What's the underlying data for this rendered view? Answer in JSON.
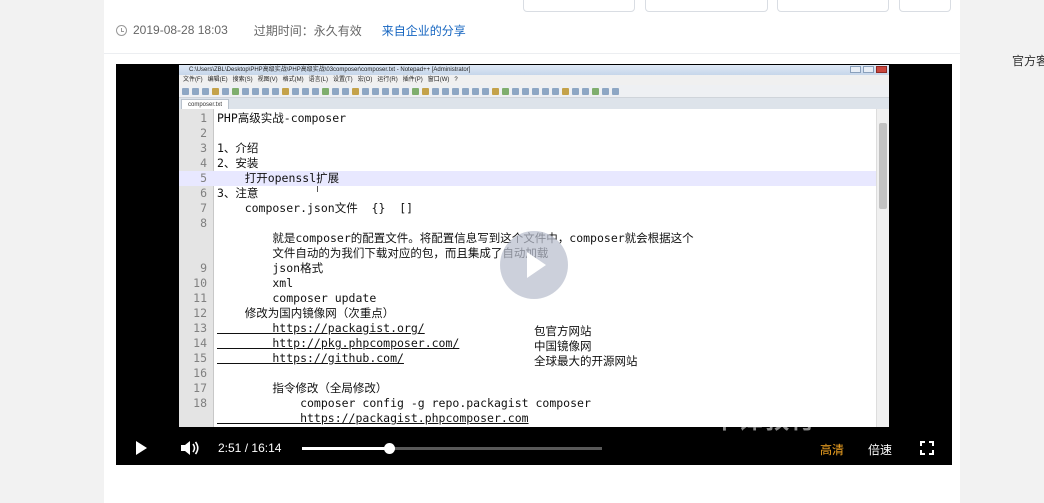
{
  "meta": {
    "datetime": "2019-08-28 18:03",
    "expiry": "过期时间：永久有效",
    "share_link": "来自企业的分享"
  },
  "sidebar": {
    "text": "官方客"
  },
  "editor": {
    "title": "C:\\Users\\ZBL\\Desktop\\PHP高级实战\\PHP高级实战\\03composer\\composer.txt - Notepad++ [Administrator]",
    "menu": [
      "文件(F)",
      "编辑(E)",
      "搜索(S)",
      "视图(V)",
      "格式(M)",
      "语言(L)",
      "设置(T)",
      "宏(O)",
      "运行(R)",
      "插件(P)",
      "窗口(W)",
      "?"
    ],
    "tab": "composer.txt",
    "lines": [
      {
        "n": "1",
        "text": "PHP高级实战-composer"
      },
      {
        "n": "2",
        "text": ""
      },
      {
        "n": "3",
        "text": "1、介绍"
      },
      {
        "n": "4",
        "text": "2、安装"
      },
      {
        "n": "5",
        "text": "    打开openssl扩展"
      },
      {
        "n": "6",
        "text": "3、注意"
      },
      {
        "n": "7",
        "text": "    composer.json文件  {}  []"
      },
      {
        "n": "8",
        "text": ""
      },
      {
        "n": "",
        "text": "        就是composer的配置文件。将配置信息写到这个文件中，composer就会根据这个"
      },
      {
        "n": "",
        "text": "        文件自动的为我们下载对应的包，而且集成了自动加载"
      },
      {
        "n": "9",
        "text": "        json格式"
      },
      {
        "n": "10",
        "text": "        xml"
      },
      {
        "n": "11",
        "text": "        composer update"
      },
      {
        "n": "12",
        "text": "    修改为国内镜像网（次重点）"
      },
      {
        "n": "13",
        "text": "        https://packagist.org/"
      },
      {
        "n": "14",
        "text": "        http://pkg.phpcomposer.com/"
      },
      {
        "n": "15",
        "text": "        https://github.com/"
      },
      {
        "n": "16",
        "text": ""
      },
      {
        "n": "17",
        "text": "        指令修改（全局修改）"
      },
      {
        "n": "18",
        "text": "            composer config -g repo.packagist composer"
      },
      {
        "n": "",
        "text": "            https://packagist.phpcomposer.com"
      }
    ],
    "notes": {
      "packagist": "包官方网站",
      "phpcomposer": "中国镜像网",
      "github": "全球最大的开源网站"
    }
  },
  "watermark": "千锋教育™",
  "player": {
    "current_time": "2:51",
    "separator": "/",
    "duration": "16:14",
    "progress_fraction": 0.289,
    "quality": "高清",
    "speed": "倍速"
  }
}
